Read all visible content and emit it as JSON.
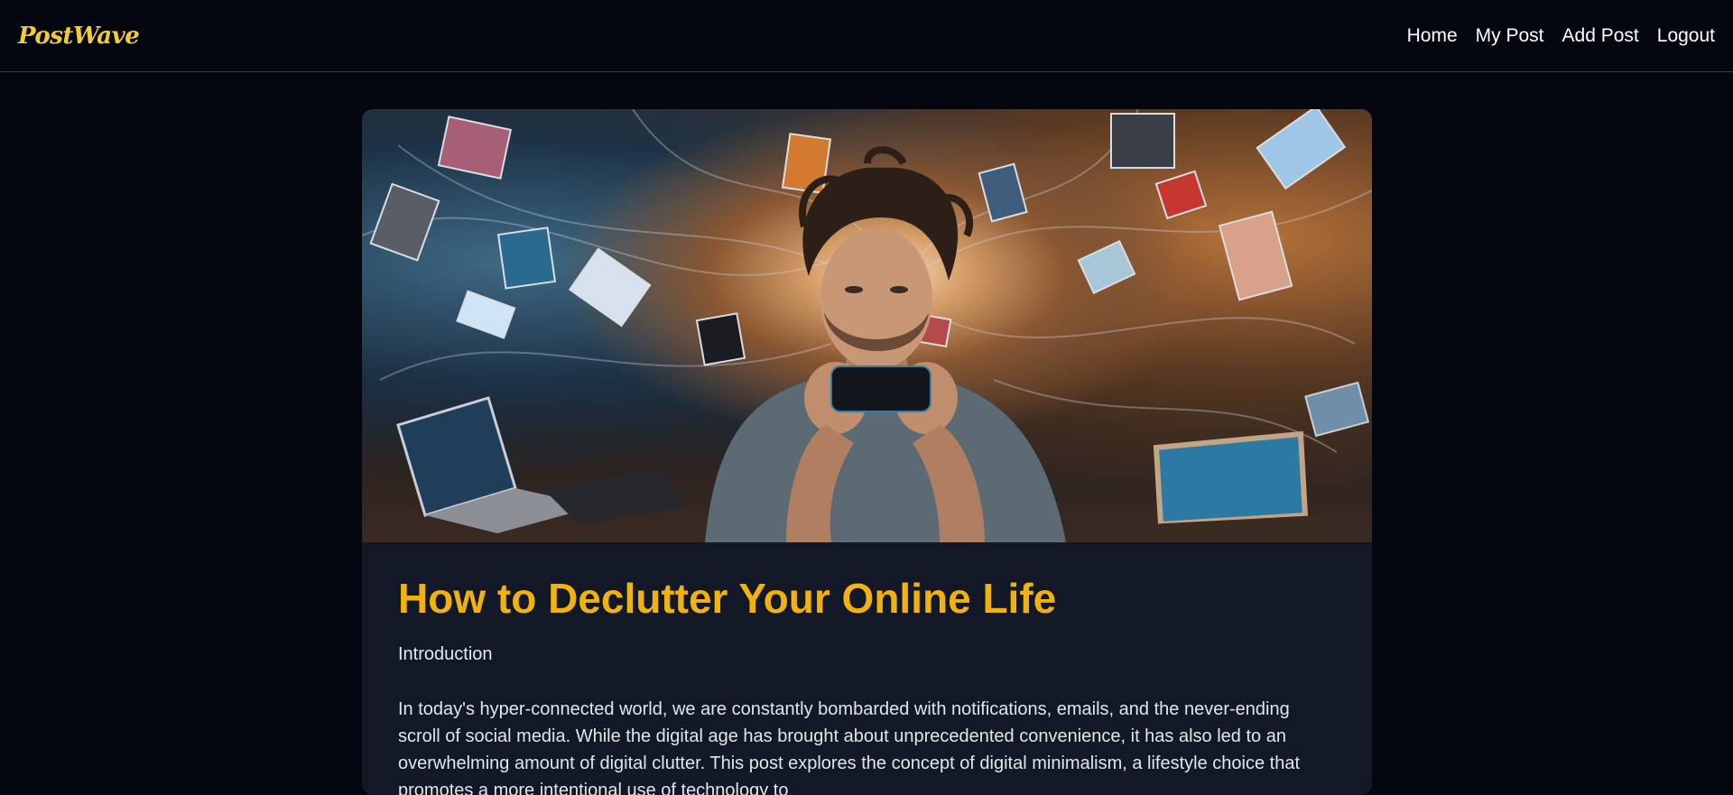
{
  "nav": {
    "logo": "PostWave",
    "links": [
      "Home",
      "My Post",
      "Add Post",
      "Logout"
    ]
  },
  "post": {
    "image_alt": "Man overwhelmed by floating devices and screens while looking at his phone",
    "title": "How to Declutter Your Online Life",
    "subheading": "Introduction",
    "body": "In today's hyper-connected world, we are constantly bombarded with notifications, emails, and the never-ending scroll of social media. While the digital age has brought about unprecedented convenience, it has also led to an overwhelming amount of digital clutter. This post explores the concept of digital minimalism, a lifestyle choice that promotes a more intentional use of technology to"
  },
  "colors": {
    "background": "#03050f",
    "card": "#121826",
    "accent": "#f1b20e",
    "logo": "#f2cd2f"
  }
}
